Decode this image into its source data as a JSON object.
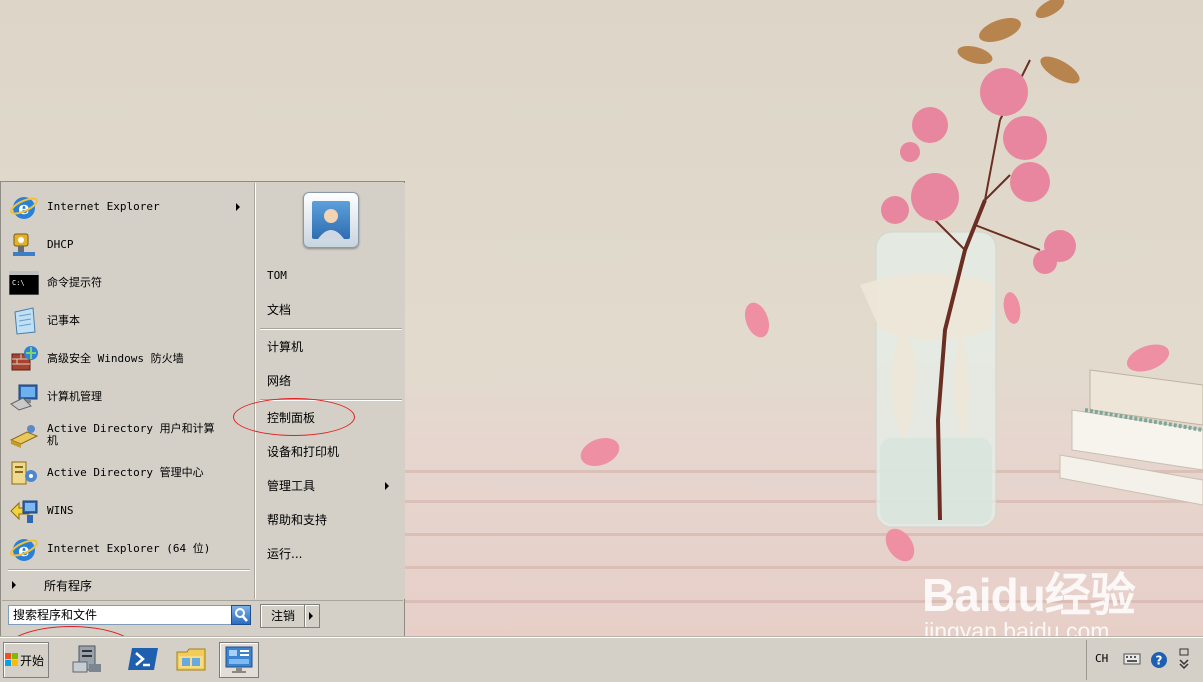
{
  "start_menu": {
    "programs": [
      {
        "label": "Internet Explorer",
        "icon": "internet-explorer-icon",
        "submenu": true
      },
      {
        "label": "DHCP",
        "icon": "dhcp-icon",
        "submenu": false
      },
      {
        "label": "命令提示符",
        "icon": "command-prompt-icon",
        "submenu": false
      },
      {
        "label": "记事本",
        "icon": "notepad-icon",
        "submenu": false
      },
      {
        "label": "高级安全 Windows 防火墙",
        "icon": "firewall-icon",
        "submenu": false
      },
      {
        "label": "计算机管理",
        "icon": "computer-management-icon",
        "submenu": false
      },
      {
        "label": "Active Directory 用户和计算机",
        "icon": "ad-users-icon",
        "submenu": false
      },
      {
        "label": "Active Directory 管理中心",
        "icon": "ad-admin-center-icon",
        "submenu": false
      },
      {
        "label": "WINS",
        "icon": "wins-icon",
        "submenu": false
      },
      {
        "label": "Internet Explorer (64 位)",
        "icon": "internet-explorer-icon",
        "submenu": false
      }
    ],
    "all_programs_label": "所有程序",
    "search_placeholder": "搜索程序和文件",
    "logoff_label": "注销",
    "user_picture_icon": "user-avatar-icon",
    "places": [
      {
        "label": "TOM"
      },
      {
        "label": "文档"
      },
      {
        "label": "计算机"
      },
      {
        "label": "网络"
      },
      {
        "label": "控制面板"
      },
      {
        "label": "设备和打印机"
      },
      {
        "label": "管理工具",
        "submenu": true
      },
      {
        "label": "帮助和支持"
      },
      {
        "label": "运行..."
      }
    ]
  },
  "taskbar": {
    "start_label": "开始",
    "pinned": [
      {
        "icon": "server-manager-icon"
      },
      {
        "icon": "powershell-icon"
      },
      {
        "icon": "windows-explorer-icon"
      },
      {
        "icon": "control-panel-icon"
      }
    ],
    "tray": {
      "language": "CH",
      "icons": [
        "keyboard-icon",
        "help-icon",
        "taskbar-options-icon"
      ]
    }
  },
  "watermark": {
    "logo": "Baidu经验",
    "site": "jingyan.baidu.com"
  },
  "annotation_color": "#e02020"
}
